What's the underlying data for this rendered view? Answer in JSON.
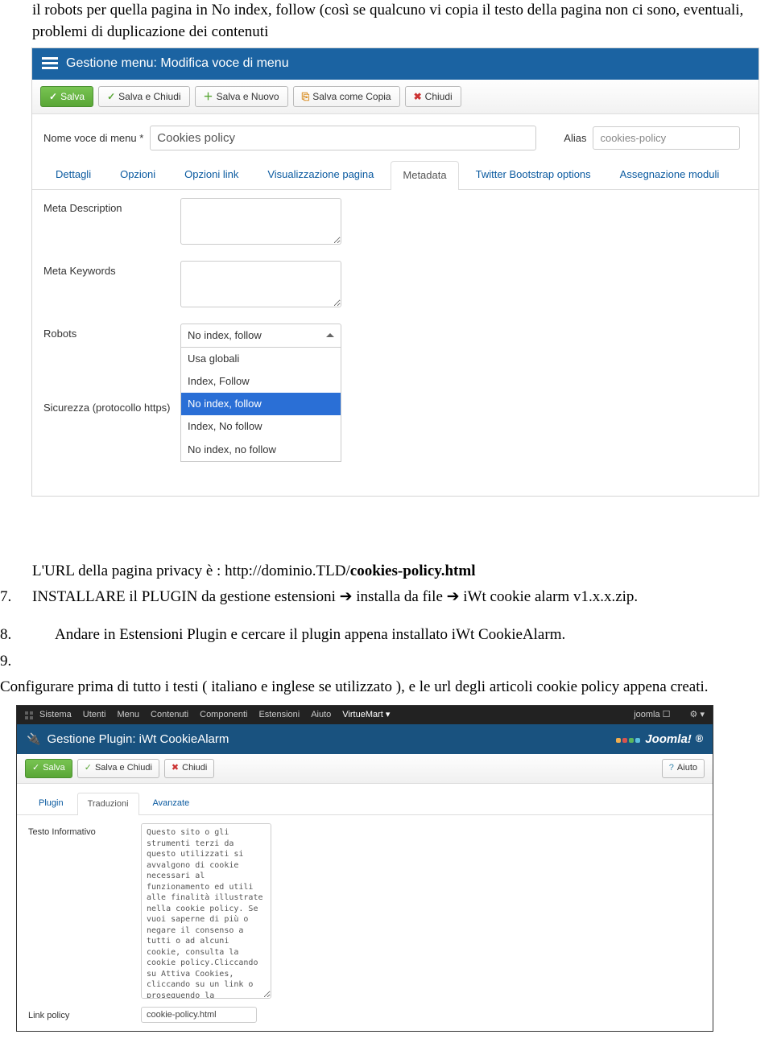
{
  "intro_text": "il robots per quella pagina in No index, follow (così se qualcuno vi copia il testo della pagina non ci sono, eventuali, problemi di duplicazione dei contenuti",
  "shot1": {
    "header_title": "Gestione menu: Modifica voce di menu",
    "toolbar": {
      "save": "Salva",
      "save_close": "Salva e Chiudi",
      "save_new": "Salva e Nuovo",
      "save_copy": "Salva come Copia",
      "close": "Chiudi"
    },
    "name_label": "Nome voce di menu *",
    "name_value": "Cookies policy",
    "alias_label": "Alias",
    "alias_value": "cookies-policy",
    "tabs": [
      "Dettagli",
      "Opzioni",
      "Opzioni link",
      "Visualizzazione pagina",
      "Metadata",
      "Twitter Bootstrap options",
      "Assegnazione moduli"
    ],
    "active_tab_index": 4,
    "meta_desc_label": "Meta Description",
    "meta_keywords_label": "Meta Keywords",
    "robots_label": "Robots",
    "sicurezza_label": "Sicurezza (protocollo https)",
    "robots_selected": "No index, follow",
    "robots_options": [
      "Usa globali",
      "Index, Follow",
      "No index, follow",
      "Index, No follow",
      "No index, no follow"
    ],
    "robots_selected_index": 2
  },
  "after_shot1": {
    "url_prefix": "L'URL della pagina privacy è : http://dominio.TLD/",
    "url_bold": "cookies-policy.html",
    "item7_num": "7.",
    "item7_text": "INSTALLARE il PLUGIN da gestione estensioni  ➔  installa da file  ➔  iWt cookie alarm v1.x.x.zip.",
    "item8_num": "8.",
    "item8_text": "Andare in Estensioni Plugin e cercare il plugin appena installato iWt CookieAlarm.",
    "item9_num": "9.",
    "item9_text": "Configurare prima di tutto i testi ( italiano e inglese se utilizzato ), e le url degli articoli cookie policy appena creati."
  },
  "shot2": {
    "topmenu": [
      "Sistema",
      "Utenti",
      "Menu",
      "Contenuti",
      "Componenti",
      "Estensioni",
      "Aiuto"
    ],
    "topmenu_active": "VirtueMart ▾",
    "top_right": "joomla ☐",
    "header_title": "Gestione Plugin: iWt CookieAlarm",
    "logo_text": "Joomla!",
    "toolbar": {
      "save": "Salva",
      "save_close": "Salva e Chiudi",
      "close": "Chiudi",
      "help": "Aiuto"
    },
    "tabs": [
      "Plugin",
      "Traduzioni",
      "Avanzate"
    ],
    "active_tab_index": 1,
    "testo_label": "Testo Informativo",
    "testo_value": "Questo sito o gli strumenti terzi da questo utilizzati si avvalgono di cookie necessari al funzionamento ed utili alle finalità illustrate nella cookie policy. Se vuoi saperne di più o negare il consenso a tutti o ad alcuni cookie, consulta la cookie policy.Cliccando su Attiva Cookies, cliccando su un link o proseguendo la navigazione in altra maniera, acconsenti all'uso dei cookie.",
    "link_label": "Link policy",
    "link_value": "cookie-policy.html"
  }
}
